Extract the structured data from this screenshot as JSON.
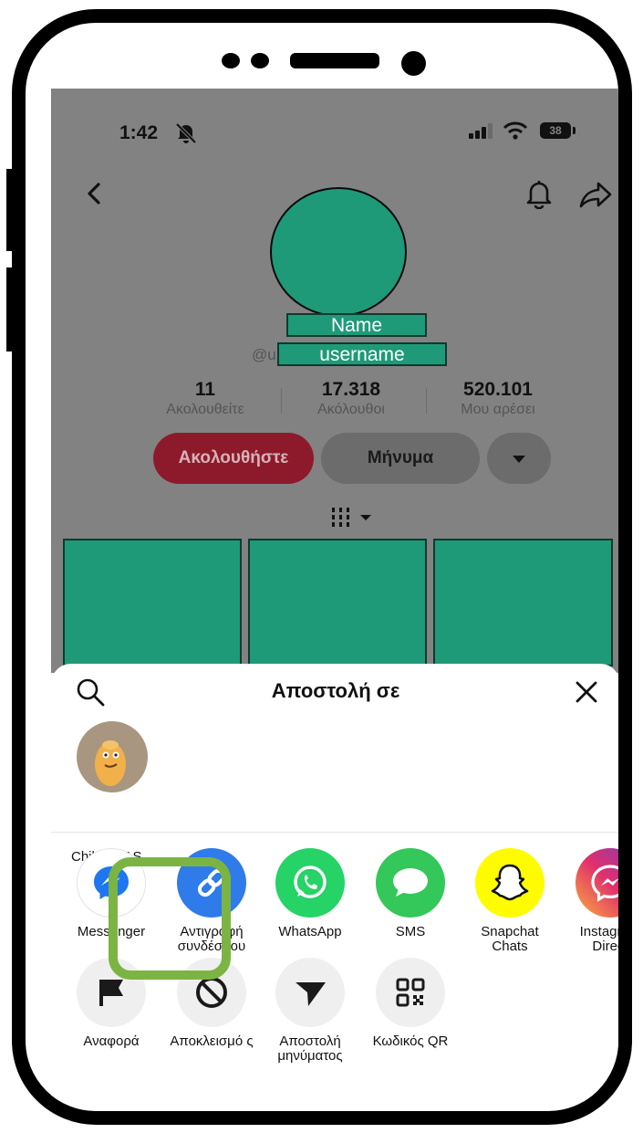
{
  "status_bar": {
    "time": "1:42",
    "battery": "38"
  },
  "profile": {
    "name": "Name",
    "username": "username",
    "username_prefix": "@u",
    "stats": [
      {
        "value": "11",
        "label": "Ακολουθείτε"
      },
      {
        "value": "17.318",
        "label": "Ακόλουθοι"
      },
      {
        "value": "520.101",
        "label": "Μου αρέσει"
      }
    ],
    "follow_label": "Ακολουθήστε",
    "message_label": "Μήνυμα"
  },
  "share_sheet": {
    "title": "Αποστολή σε",
    "contacts": [
      {
        "name": "Child CFAS"
      }
    ],
    "apps": [
      {
        "label": "Messenger",
        "icon": "messenger-icon",
        "color": "#1e77f0"
      },
      {
        "label": "Αντιγραφή συνδέσμου",
        "icon": "link-icon",
        "color": "#2f7bea"
      },
      {
        "label": "WhatsApp",
        "icon": "whatsapp-icon",
        "color": "#25d366"
      },
      {
        "label": "SMS",
        "icon": "sms-icon",
        "color": "#34c759"
      },
      {
        "label": "Snapchat Chats",
        "icon": "snapchat-icon",
        "color": "#fffc00"
      },
      {
        "label": "Instagram Direct",
        "icon": "instagram-icon",
        "color": "#e1306c"
      }
    ],
    "actions": [
      {
        "label": "Αναφορά",
        "icon": "flag-icon"
      },
      {
        "label": "Αποκλεισμό ς",
        "icon": "block-icon"
      },
      {
        "label": "Αποστολή μηνύματος",
        "icon": "send-icon"
      },
      {
        "label": "Κωδικός QR",
        "icon": "qr-code-icon"
      }
    ]
  },
  "colors": {
    "highlight": "#7bb443",
    "redaction": "#1f9a78",
    "follow": "#8d1a2b"
  }
}
